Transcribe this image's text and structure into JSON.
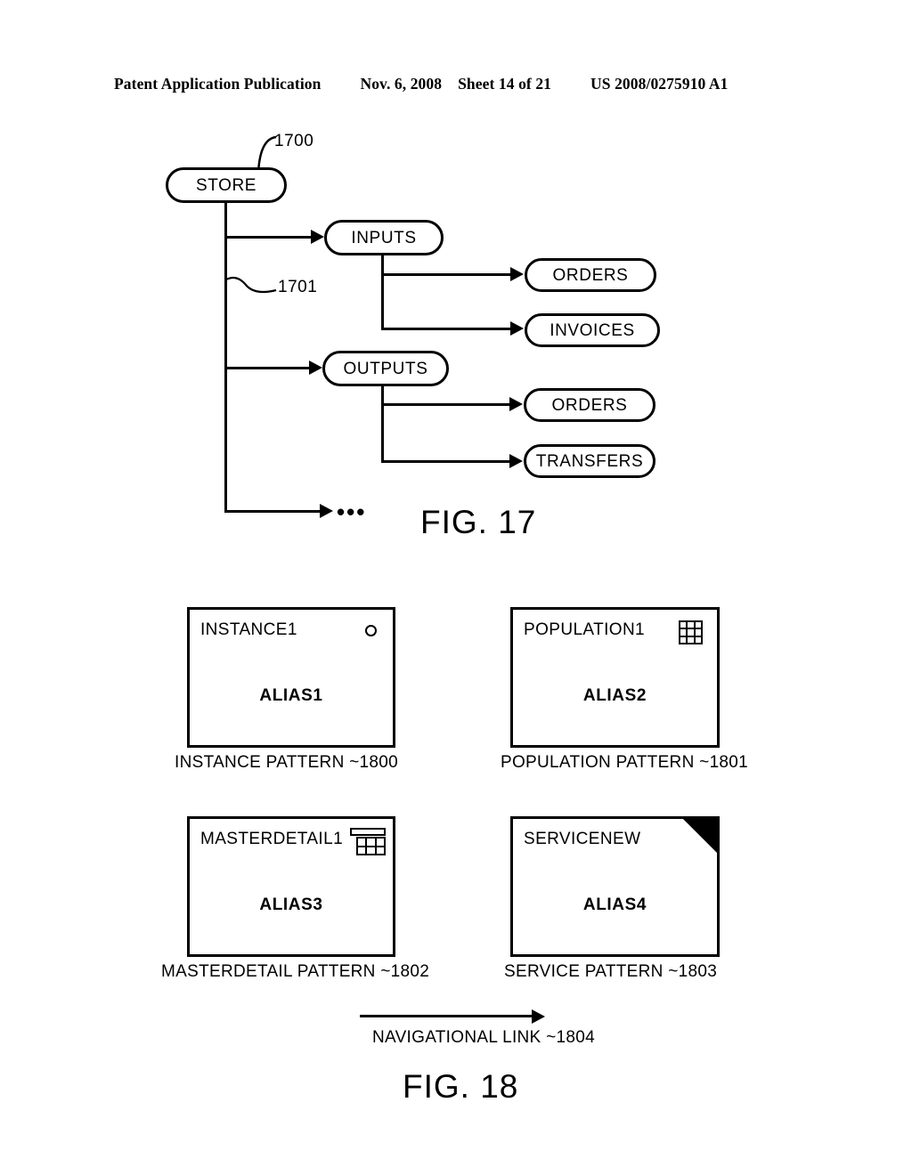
{
  "header": {
    "publication": "Patent Application Publication",
    "date": "Nov. 6, 2008",
    "sheet": "Sheet 14 of 21",
    "document_number": "US 2008/0275910 A1"
  },
  "figure17": {
    "caption": "FIG. 17",
    "root": {
      "label": "STORE",
      "ref": "1700"
    },
    "trunk_ref": "1701",
    "ellipsis": "•••",
    "branches": [
      {
        "label": "INPUTS",
        "children": [
          {
            "label": "ORDERS"
          },
          {
            "label": "INVOICES"
          }
        ]
      },
      {
        "label": "OUTPUTS",
        "children": [
          {
            "label": "ORDERS"
          },
          {
            "label": "TRANSFERS"
          }
        ]
      }
    ]
  },
  "figure18": {
    "caption": "FIG. 18",
    "patterns": [
      {
        "title": "INSTANCE1",
        "alias": "ALIAS1",
        "caption": "INSTANCE PATTERN  ~1800",
        "icon": "circle-icon"
      },
      {
        "title": "POPULATION1",
        "alias": "ALIAS2",
        "caption": "POPULATION PATTERN  ~1801",
        "icon": "grid-3x3-icon"
      },
      {
        "title": "MASTERDETAIL1",
        "alias": "ALIAS3",
        "caption": "MASTERDETAIL PATTERN  ~1802",
        "icon": "master-detail-icon"
      },
      {
        "title": "SERVICENEW",
        "alias": "ALIAS4",
        "caption": "SERVICE PATTERN  ~1803",
        "icon": "corner-fold-icon"
      }
    ],
    "navigational_link": {
      "label": "NAVIGATIONAL LINK  ~1804",
      "icon": "arrow-right-icon"
    }
  },
  "colors": {
    "ink": "#000000",
    "paper": "#ffffff"
  }
}
